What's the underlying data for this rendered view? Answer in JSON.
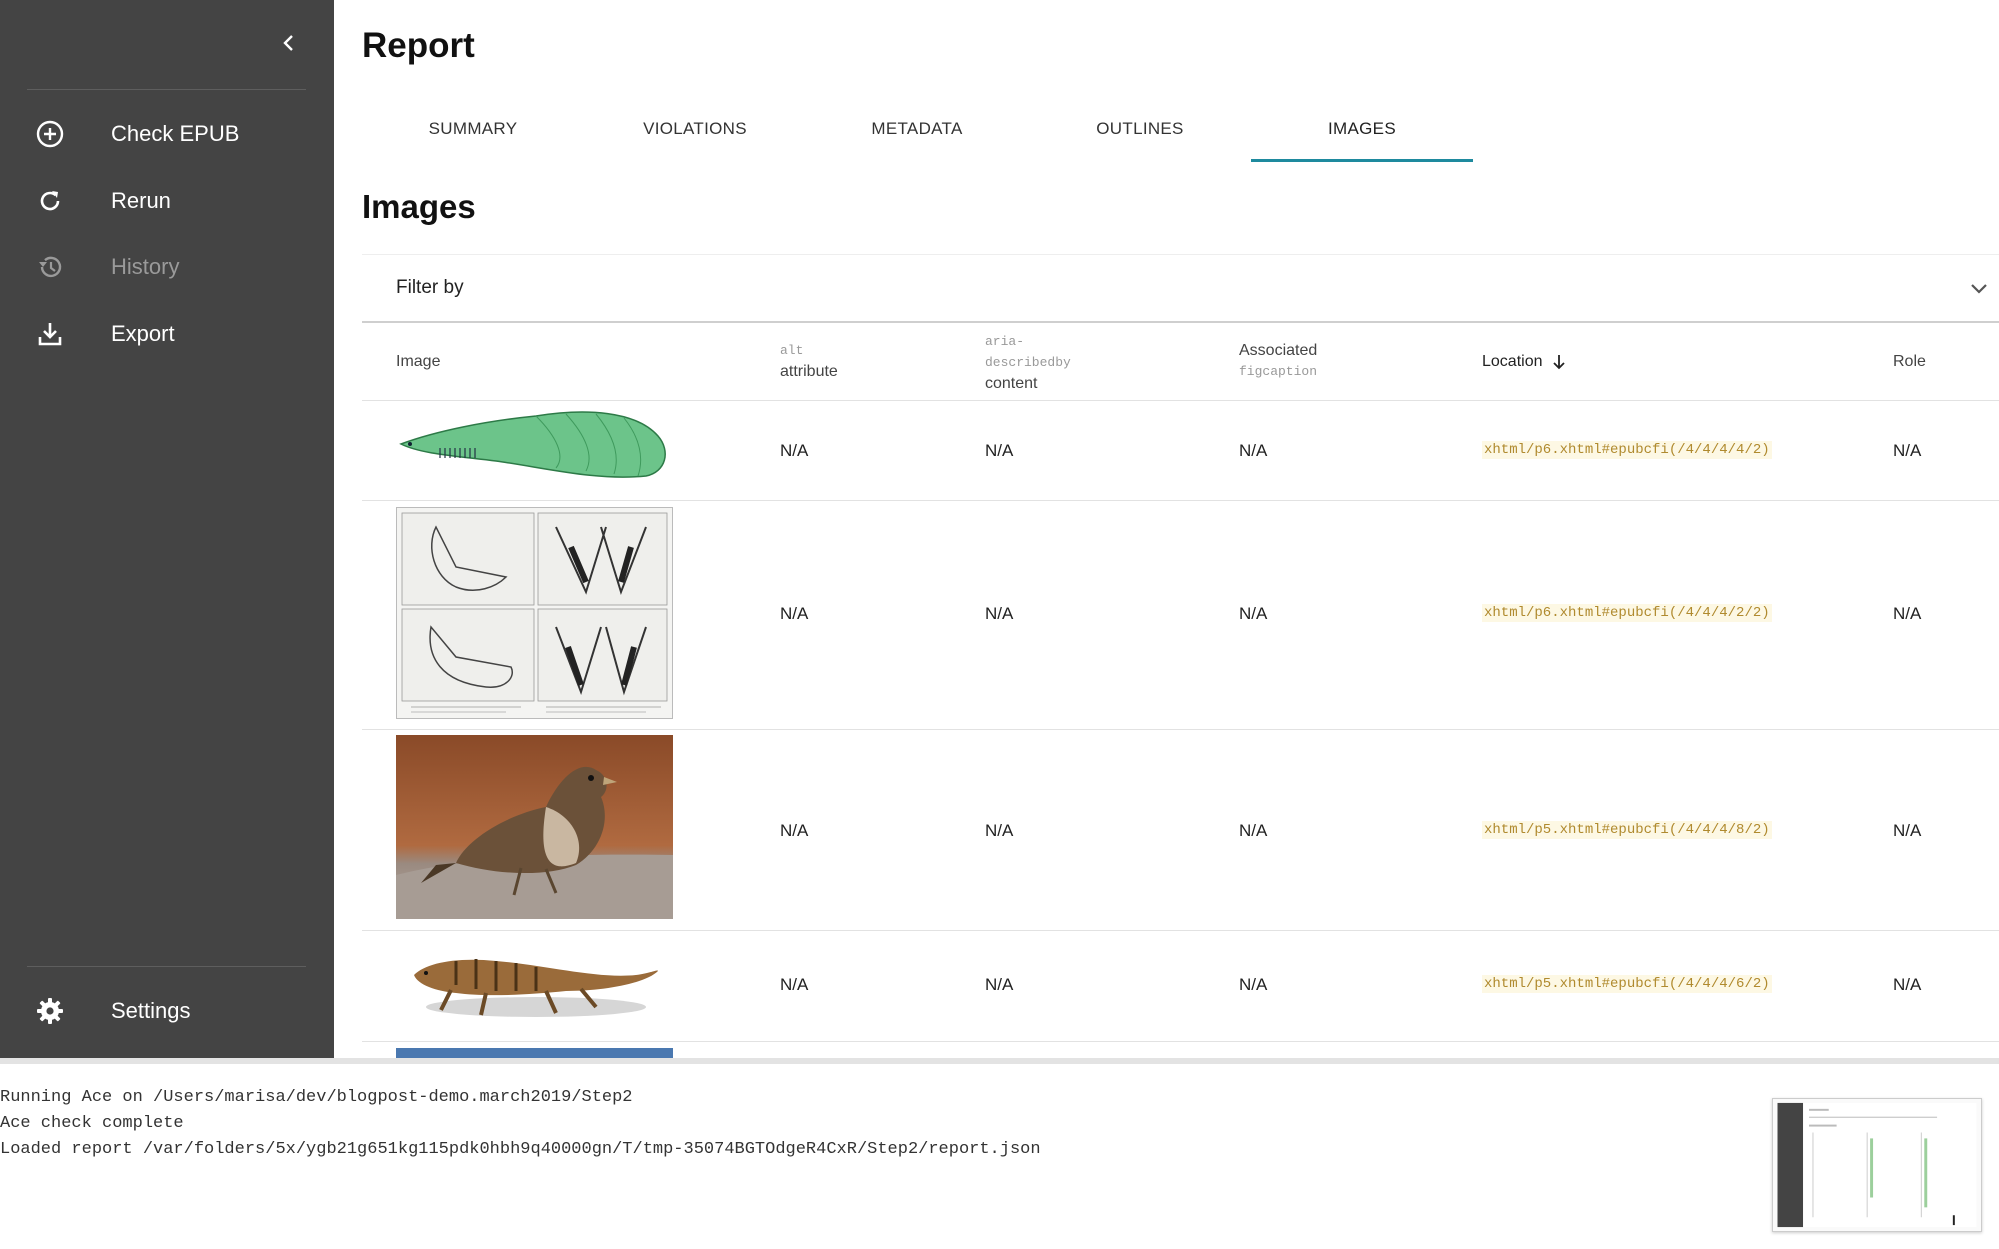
{
  "sidebar": {
    "items": [
      {
        "label": "Check EPUB",
        "icon": "plus-circle-icon"
      },
      {
        "label": "Rerun",
        "icon": "refresh-icon"
      },
      {
        "label": "History",
        "icon": "history-icon",
        "disabled": true
      },
      {
        "label": "Export",
        "icon": "download-icon"
      }
    ],
    "settings_label": "Settings"
  },
  "header": {
    "title": "Report"
  },
  "tabs": [
    {
      "label": "SUMMARY"
    },
    {
      "label": "VIOLATIONS"
    },
    {
      "label": "METADATA"
    },
    {
      "label": "OUTLINES"
    },
    {
      "label": "IMAGES",
      "active": true
    }
  ],
  "images_section": {
    "title": "Images",
    "filter_label": "Filter by",
    "columns": {
      "image": "Image",
      "alt_code": "alt",
      "alt_text": "attribute",
      "aria_code_1": "aria-",
      "aria_code_2": "describedby",
      "aria_text": "content",
      "assoc_text": "Associated",
      "assoc_code": "figcaption",
      "location": "Location",
      "role": "Role"
    },
    "rows": [
      {
        "image": "fish illustration",
        "alt": "N/A",
        "aria": "N/A",
        "figcaption": "N/A",
        "location": "xhtml/p6.xhtml#epubcfi(/4/4/4/4/2)",
        "role": "N/A"
      },
      {
        "image": "jaw bone engravings",
        "alt": "N/A",
        "aria": "N/A",
        "figcaption": "N/A",
        "location": "xhtml/p6.xhtml#epubcfi(/4/4/4/2/2)",
        "role": "N/A"
      },
      {
        "image": "sparrow photo",
        "alt": "N/A",
        "aria": "N/A",
        "figcaption": "N/A",
        "location": "xhtml/p5.xhtml#epubcfi(/4/4/4/8/2)",
        "role": "N/A"
      },
      {
        "image": "lizard-like animal illustration",
        "alt": "N/A",
        "aria": "N/A",
        "figcaption": "N/A",
        "location": "xhtml/p5.xhtml#epubcfi(/4/4/4/6/2)",
        "role": "N/A"
      }
    ]
  },
  "console": {
    "lines": [
      "Running Ace on /Users/marisa/dev/blogpost-demo.march2019/Step2",
      "Ace check complete",
      "Loaded report /var/folders/5x/ygb21g651kg115pdk0hbh9q40000gn/T/tmp-35074BGTOdgeR4CxR/Step2/report.json"
    ]
  },
  "colors": {
    "sidebar_bg": "#444444",
    "tab_indicator": "#1e8a9e",
    "location_text": "#b08a2e",
    "location_bg": "#fdf8e4"
  }
}
